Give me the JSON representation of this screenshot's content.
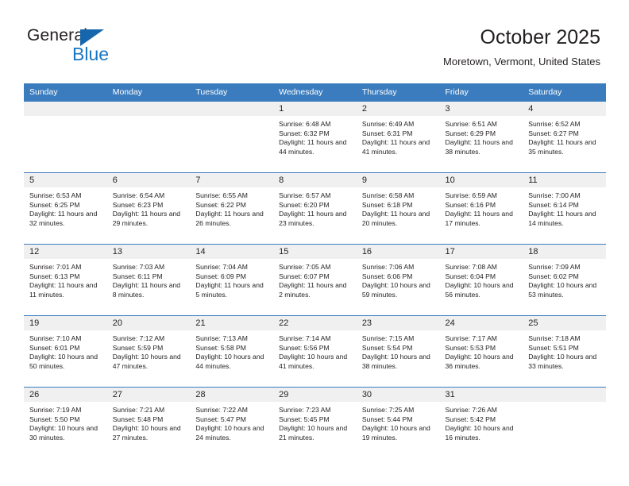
{
  "brand": {
    "name_part1": "General",
    "name_part2": "Blue",
    "accent_color": "#1a77c4",
    "triangle_color": "#1666ad"
  },
  "header": {
    "title": "October 2025",
    "subtitle": "Moretown, Vermont, United States"
  },
  "calendar": {
    "header_bg": "#3a7cbe",
    "daynum_bg": "#f0f0f0",
    "weekdays": [
      "Sunday",
      "Monday",
      "Tuesday",
      "Wednesday",
      "Thursday",
      "Friday",
      "Saturday"
    ],
    "weeks": [
      [
        {
          "day": "",
          "sunrise": "",
          "sunset": "",
          "daylight": "",
          "empty": true
        },
        {
          "day": "",
          "sunrise": "",
          "sunset": "",
          "daylight": "",
          "empty": true
        },
        {
          "day": "",
          "sunrise": "",
          "sunset": "",
          "daylight": "",
          "empty": true
        },
        {
          "day": "1",
          "sunrise": "Sunrise: 6:48 AM",
          "sunset": "Sunset: 6:32 PM",
          "daylight": "Daylight: 11 hours and 44 minutes."
        },
        {
          "day": "2",
          "sunrise": "Sunrise: 6:49 AM",
          "sunset": "Sunset: 6:31 PM",
          "daylight": "Daylight: 11 hours and 41 minutes."
        },
        {
          "day": "3",
          "sunrise": "Sunrise: 6:51 AM",
          "sunset": "Sunset: 6:29 PM",
          "daylight": "Daylight: 11 hours and 38 minutes."
        },
        {
          "day": "4",
          "sunrise": "Sunrise: 6:52 AM",
          "sunset": "Sunset: 6:27 PM",
          "daylight": "Daylight: 11 hours and 35 minutes."
        }
      ],
      [
        {
          "day": "5",
          "sunrise": "Sunrise: 6:53 AM",
          "sunset": "Sunset: 6:25 PM",
          "daylight": "Daylight: 11 hours and 32 minutes."
        },
        {
          "day": "6",
          "sunrise": "Sunrise: 6:54 AM",
          "sunset": "Sunset: 6:23 PM",
          "daylight": "Daylight: 11 hours and 29 minutes."
        },
        {
          "day": "7",
          "sunrise": "Sunrise: 6:55 AM",
          "sunset": "Sunset: 6:22 PM",
          "daylight": "Daylight: 11 hours and 26 minutes."
        },
        {
          "day": "8",
          "sunrise": "Sunrise: 6:57 AM",
          "sunset": "Sunset: 6:20 PM",
          "daylight": "Daylight: 11 hours and 23 minutes."
        },
        {
          "day": "9",
          "sunrise": "Sunrise: 6:58 AM",
          "sunset": "Sunset: 6:18 PM",
          "daylight": "Daylight: 11 hours and 20 minutes."
        },
        {
          "day": "10",
          "sunrise": "Sunrise: 6:59 AM",
          "sunset": "Sunset: 6:16 PM",
          "daylight": "Daylight: 11 hours and 17 minutes."
        },
        {
          "day": "11",
          "sunrise": "Sunrise: 7:00 AM",
          "sunset": "Sunset: 6:14 PM",
          "daylight": "Daylight: 11 hours and 14 minutes."
        }
      ],
      [
        {
          "day": "12",
          "sunrise": "Sunrise: 7:01 AM",
          "sunset": "Sunset: 6:13 PM",
          "daylight": "Daylight: 11 hours and 11 minutes."
        },
        {
          "day": "13",
          "sunrise": "Sunrise: 7:03 AM",
          "sunset": "Sunset: 6:11 PM",
          "daylight": "Daylight: 11 hours and 8 minutes."
        },
        {
          "day": "14",
          "sunrise": "Sunrise: 7:04 AM",
          "sunset": "Sunset: 6:09 PM",
          "daylight": "Daylight: 11 hours and 5 minutes."
        },
        {
          "day": "15",
          "sunrise": "Sunrise: 7:05 AM",
          "sunset": "Sunset: 6:07 PM",
          "daylight": "Daylight: 11 hours and 2 minutes."
        },
        {
          "day": "16",
          "sunrise": "Sunrise: 7:06 AM",
          "sunset": "Sunset: 6:06 PM",
          "daylight": "Daylight: 10 hours and 59 minutes."
        },
        {
          "day": "17",
          "sunrise": "Sunrise: 7:08 AM",
          "sunset": "Sunset: 6:04 PM",
          "daylight": "Daylight: 10 hours and 56 minutes."
        },
        {
          "day": "18",
          "sunrise": "Sunrise: 7:09 AM",
          "sunset": "Sunset: 6:02 PM",
          "daylight": "Daylight: 10 hours and 53 minutes."
        }
      ],
      [
        {
          "day": "19",
          "sunrise": "Sunrise: 7:10 AM",
          "sunset": "Sunset: 6:01 PM",
          "daylight": "Daylight: 10 hours and 50 minutes."
        },
        {
          "day": "20",
          "sunrise": "Sunrise: 7:12 AM",
          "sunset": "Sunset: 5:59 PM",
          "daylight": "Daylight: 10 hours and 47 minutes."
        },
        {
          "day": "21",
          "sunrise": "Sunrise: 7:13 AM",
          "sunset": "Sunset: 5:58 PM",
          "daylight": "Daylight: 10 hours and 44 minutes."
        },
        {
          "day": "22",
          "sunrise": "Sunrise: 7:14 AM",
          "sunset": "Sunset: 5:56 PM",
          "daylight": "Daylight: 10 hours and 41 minutes."
        },
        {
          "day": "23",
          "sunrise": "Sunrise: 7:15 AM",
          "sunset": "Sunset: 5:54 PM",
          "daylight": "Daylight: 10 hours and 38 minutes."
        },
        {
          "day": "24",
          "sunrise": "Sunrise: 7:17 AM",
          "sunset": "Sunset: 5:53 PM",
          "daylight": "Daylight: 10 hours and 36 minutes."
        },
        {
          "day": "25",
          "sunrise": "Sunrise: 7:18 AM",
          "sunset": "Sunset: 5:51 PM",
          "daylight": "Daylight: 10 hours and 33 minutes."
        }
      ],
      [
        {
          "day": "26",
          "sunrise": "Sunrise: 7:19 AM",
          "sunset": "Sunset: 5:50 PM",
          "daylight": "Daylight: 10 hours and 30 minutes."
        },
        {
          "day": "27",
          "sunrise": "Sunrise: 7:21 AM",
          "sunset": "Sunset: 5:48 PM",
          "daylight": "Daylight: 10 hours and 27 minutes."
        },
        {
          "day": "28",
          "sunrise": "Sunrise: 7:22 AM",
          "sunset": "Sunset: 5:47 PM",
          "daylight": "Daylight: 10 hours and 24 minutes."
        },
        {
          "day": "29",
          "sunrise": "Sunrise: 7:23 AM",
          "sunset": "Sunset: 5:45 PM",
          "daylight": "Daylight: 10 hours and 21 minutes."
        },
        {
          "day": "30",
          "sunrise": "Sunrise: 7:25 AM",
          "sunset": "Sunset: 5:44 PM",
          "daylight": "Daylight: 10 hours and 19 minutes."
        },
        {
          "day": "31",
          "sunrise": "Sunrise: 7:26 AM",
          "sunset": "Sunset: 5:42 PM",
          "daylight": "Daylight: 10 hours and 16 minutes."
        },
        {
          "day": "",
          "sunrise": "",
          "sunset": "",
          "daylight": "",
          "empty": true
        }
      ]
    ]
  }
}
